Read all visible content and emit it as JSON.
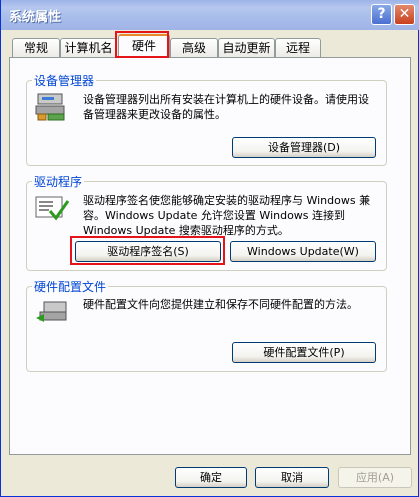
{
  "window": {
    "title": "系统属性"
  },
  "titlebar": {
    "help_glyph": "?",
    "close_glyph": "✕"
  },
  "tabs": [
    {
      "label": "常规"
    },
    {
      "label": "计算机名"
    },
    {
      "label": "硬件"
    },
    {
      "label": "高级"
    },
    {
      "label": "自动更新"
    },
    {
      "label": "远程"
    }
  ],
  "active_tab": "硬件",
  "groups": {
    "device_manager": {
      "label": "设备管理器",
      "description": "设备管理器列出所有安装在计算机上的硬件设备。请使用设备管理器来更改设备的属性。",
      "button": "设备管理器(D)",
      "icon": "device-manager-icon"
    },
    "drivers": {
      "label": "驱动程序",
      "description": "驱动程序签名使您能够确定安装的驱动程序与 Windows 兼容。Windows Update 允许您设置 Windows 连接到 Windows Update 搜索驱动程序的方式。",
      "signing_button": "驱动程序签名(S)",
      "update_button": "Windows Update(W)",
      "icon": "driver-signing-icon"
    },
    "hardware_profiles": {
      "label": "硬件配置文件",
      "description": "硬件配置文件向您提供建立和保存不同硬件配置的方法。",
      "button": "硬件配置文件(P)",
      "icon": "hardware-profiles-icon"
    }
  },
  "footer": {
    "ok": "确定",
    "cancel": "取消",
    "apply": "应用(A)"
  },
  "colors": {
    "titlebar": "#a8bdeb",
    "group_label": "#0046d5",
    "highlight": "#e5141b",
    "tab_accent": "#e68b2c"
  }
}
